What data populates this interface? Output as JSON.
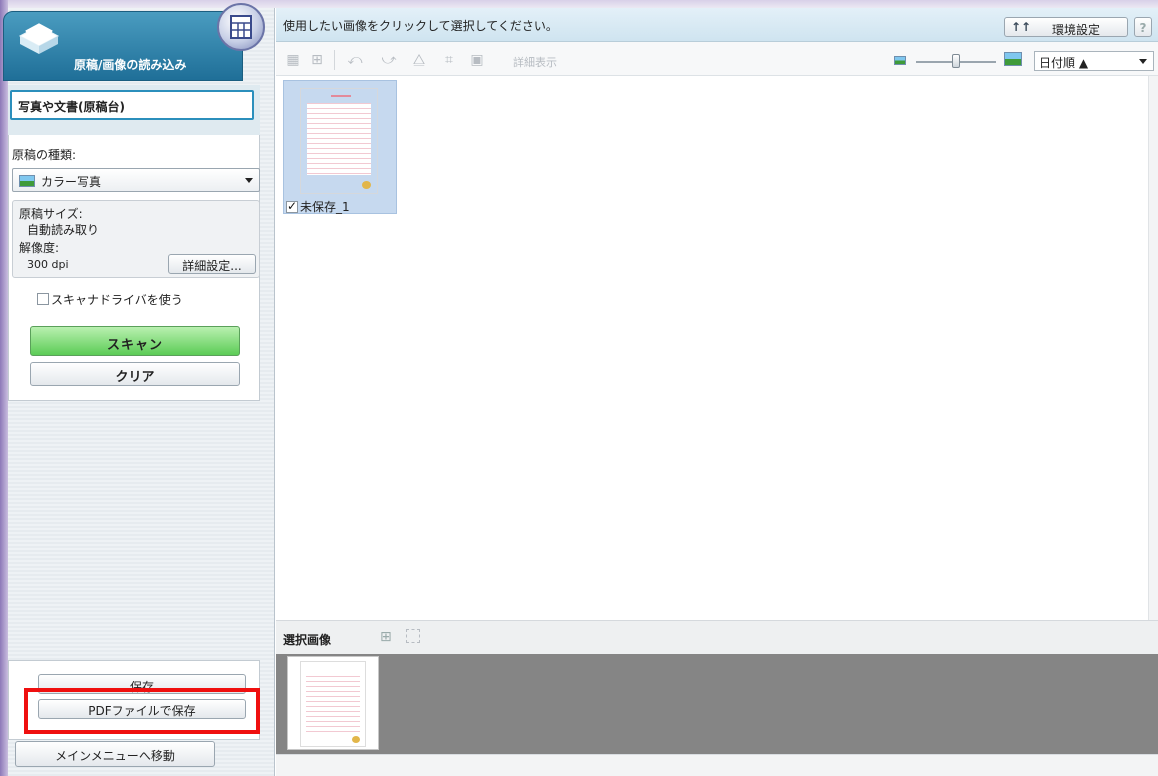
{
  "mode": {
    "title": "原稿/画像の読み込み"
  },
  "source": {
    "label": "写真や文書(原稿台)"
  },
  "settings": {
    "doc_type_label": "原稿の種類:",
    "doc_type_value": "カラー写真",
    "size_label": "原稿サイズ:",
    "size_value": "自動読み取り",
    "resolution_label": "解像度:",
    "resolution_value": "300 dpi",
    "details_button": "詳細設定...",
    "driver_checkbox": "スキャナドライバを使う",
    "scan_button": "スキャン",
    "clear_button": "クリア"
  },
  "save": {
    "save_button": "保存",
    "pdf_button": "PDFファイルで保存"
  },
  "nav": {
    "main_menu_button": "メインメニューへ移動"
  },
  "topbar": {
    "instruction": "使用したい画像をクリックして選択してください。",
    "env_button": "環境設定",
    "help_button": "?"
  },
  "toolbar": {
    "detail_view": "詳細表示",
    "sort_value": "日付順 ▲"
  },
  "thumbnails": [
    {
      "label": "未保存_1",
      "checked": true
    }
  ],
  "selected": {
    "title": "選択画像"
  },
  "colors": {
    "highlight": "#ef0f0f",
    "scan_green": "#5ccc56",
    "header_blue": "#1f6f98"
  }
}
